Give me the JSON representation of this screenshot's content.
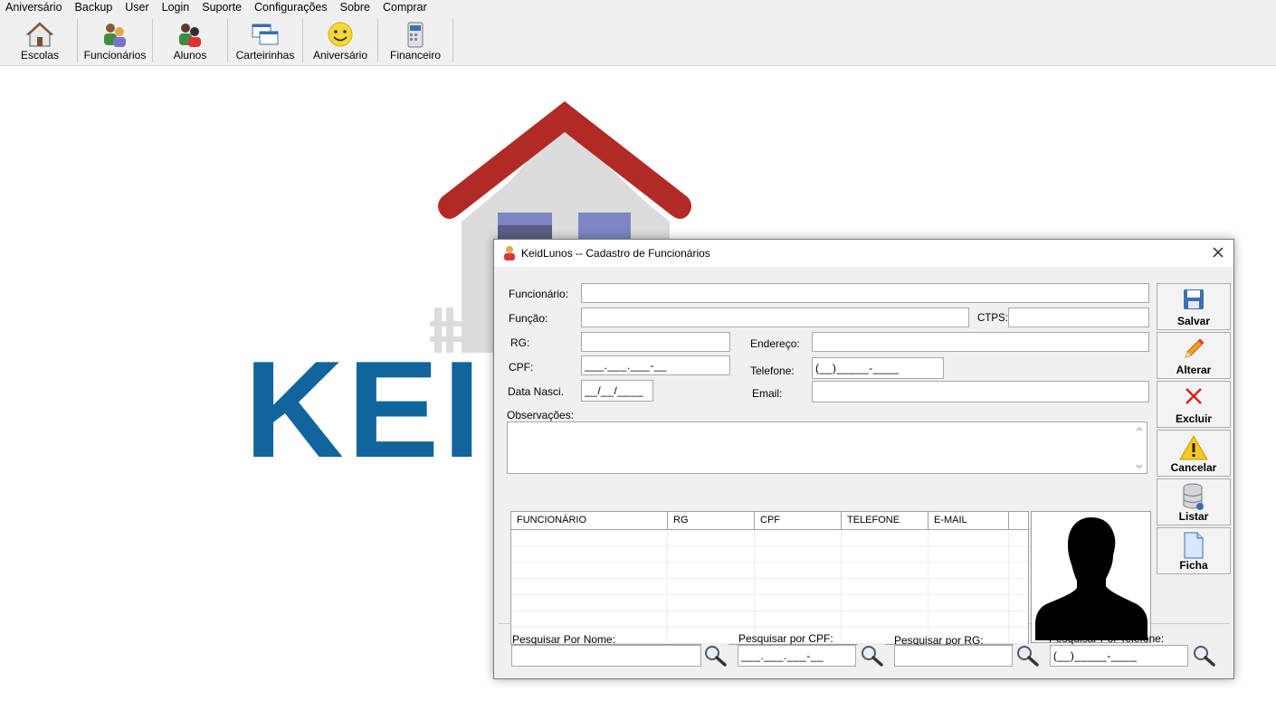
{
  "menu": [
    "Aniversário",
    "Backup",
    "User",
    "Login",
    "Suporte",
    "Configurações",
    "Sobre",
    "Comprar"
  ],
  "toolbar": {
    "escolas": "Escolas",
    "funcionarios": "Funcionários",
    "alunos": "Alunos",
    "carteirinhas": "Carteirinhas",
    "aniversario": "Aniversário",
    "financeiro": "Financeiro"
  },
  "background": {
    "logo_text": "KEID"
  },
  "dialog": {
    "title": "KeidLunos -- Cadastro de Funcionários",
    "labels": {
      "funcionario": "Funcionário:",
      "funcao": "Função:",
      "ctps": "CTPS:",
      "rg": "RG:",
      "endereco": "Endereço:",
      "cpf": "CPF:",
      "telefone": "Telefone:",
      "data_nasci": "Data Nasci.",
      "email": "Email:",
      "observacoes": "Observações:"
    },
    "values": {
      "funcionario": "",
      "funcao": "",
      "ctps": "",
      "rg": "",
      "endereco": "",
      "cpf": "___.___.___-__",
      "telefone": "(__)_____-____",
      "data_nasci": "__/__/____",
      "email": "",
      "observacoes": ""
    },
    "buttons": {
      "salvar": "Salvar",
      "alterar": "Alterar",
      "excluir": "Excluir",
      "cancelar": "Cancelar",
      "listar": "Listar",
      "ficha": "Ficha"
    },
    "grid": {
      "columns": [
        "FUNCIONÁRIO",
        "RG",
        "CPF",
        "TELEFONE",
        "E-MAIL"
      ],
      "rows": []
    },
    "search": {
      "por_nome": "Pesquisar Por Nome:",
      "por_cpf": "Pesquisar por CPF:",
      "por_rg": "Pesquisar por RG:",
      "por_telefone": "Pesquisar Por Telefone:",
      "nome_value": "",
      "cpf_value": "___.___.___-__",
      "rg_value": "",
      "telefone_value": "(__)_____-____"
    }
  },
  "colors": {
    "roof": "#b22a26",
    "house_wall": "#dcdcdc",
    "window": "#7b87c4",
    "logo_text": "#0f659c",
    "dialog_bg": "#f0f0f0"
  }
}
